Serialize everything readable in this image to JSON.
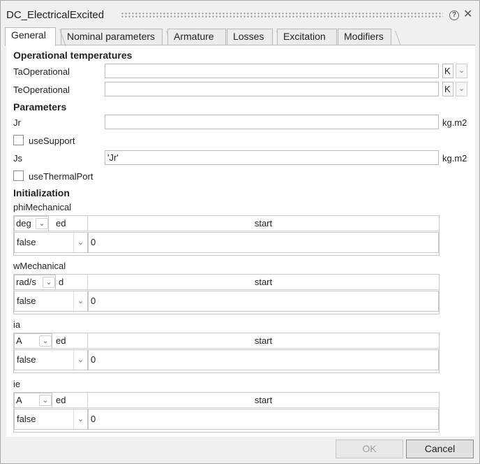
{
  "window": {
    "title": "DC_ElectricalExcited"
  },
  "tabs": [
    "General",
    "Nominal parameters",
    "Armature",
    "Losses",
    "Excitation",
    "Modifiers"
  ],
  "sections": {
    "operational": "Operational temperatures",
    "parameters": "Parameters",
    "initialization": "Initialization"
  },
  "fields": {
    "ta": {
      "label": "TaOperational",
      "value": "",
      "unit": "K"
    },
    "te": {
      "label": "TeOperational",
      "value": "",
      "unit": "K"
    },
    "jr": {
      "label": "Jr",
      "value": "",
      "unit": "kg.m2"
    },
    "useSupport": {
      "label": "useSupport"
    },
    "js": {
      "label": "Js",
      "value": "'Jr'",
      "unit": "kg.m2"
    },
    "useThermalPort": {
      "label": "useThermalPort"
    }
  },
  "grids": [
    {
      "label": "phiMechanical",
      "unit": "deg",
      "fixed_header": "ed",
      "start_header": "start",
      "fixed": "false",
      "start": "0"
    },
    {
      "label": "wMechanical",
      "unit": "rad/s",
      "fixed_header": "d",
      "start_header": "start",
      "fixed": "false",
      "start": "0"
    },
    {
      "label": "ia",
      "unit": "A",
      "fixed_header": "ed",
      "start_header": "start",
      "fixed": "false",
      "start": "0"
    },
    {
      "label": "ie",
      "unit": "A",
      "fixed_header": "ed",
      "start_header": "start",
      "fixed": "false",
      "start": "0"
    }
  ],
  "buttons": {
    "ok": "OK",
    "cancel": "Cancel"
  }
}
